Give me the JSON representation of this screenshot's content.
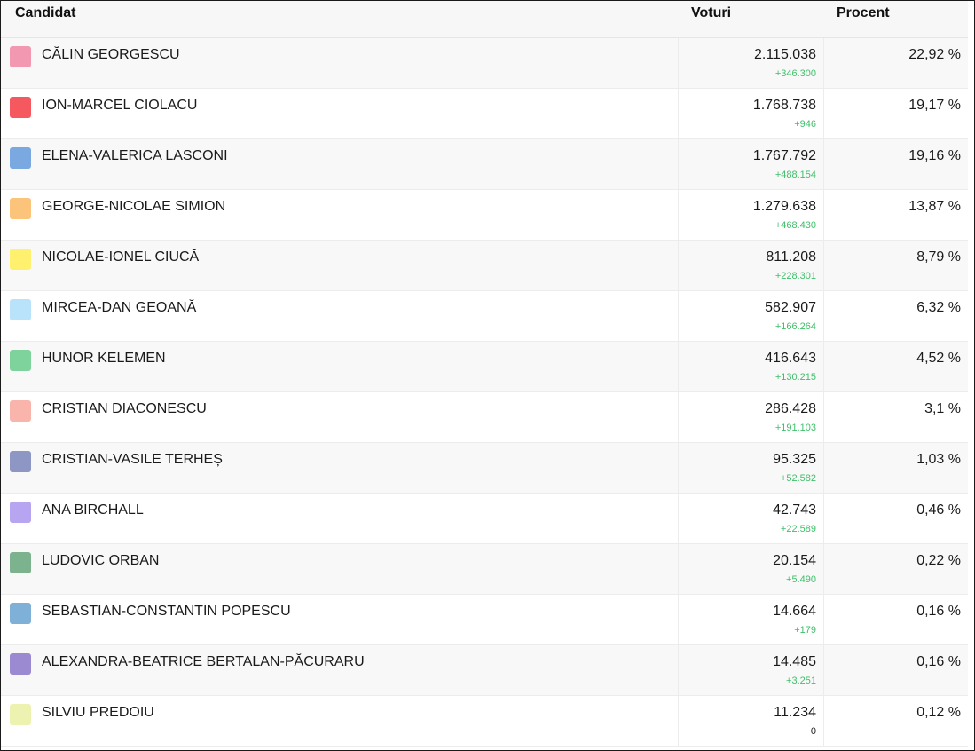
{
  "table": {
    "headers": {
      "candidate": "Candidat",
      "votes": "Voturi",
      "percent": "Procent"
    },
    "rows": [
      {
        "name": "CĂLIN GEORGESCU",
        "votes": "2.115.038",
        "delta": "+346.300",
        "percent": "22,92 %",
        "color": "#f299b1"
      },
      {
        "name": "ION-MARCEL CIOLACU",
        "votes": "1.768.738",
        "delta": "+946",
        "percent": "19,17 %",
        "color": "#f5585f"
      },
      {
        "name": "ELENA-VALERICA LASCONI",
        "votes": "1.767.792",
        "delta": "+488.154",
        "percent": "19,16 %",
        "color": "#79a9e0"
      },
      {
        "name": "GEORGE-NICOLAE SIMION",
        "votes": "1.279.638",
        "delta": "+468.430",
        "percent": "13,87 %",
        "color": "#fbc47a"
      },
      {
        "name": "NICOLAE-IONEL CIUCĂ",
        "votes": "811.208",
        "delta": "+228.301",
        "percent": "8,79 %",
        "color": "#fff06e"
      },
      {
        "name": "MIRCEA-DAN GEOANĂ",
        "votes": "582.907",
        "delta": "+166.264",
        "percent": "6,32 %",
        "color": "#b9e2fb"
      },
      {
        "name": "HUNOR KELEMEN",
        "votes": "416.643",
        "delta": "+130.215",
        "percent": "4,52 %",
        "color": "#7ed29c"
      },
      {
        "name": "CRISTIAN DIACONESCU",
        "votes": "286.428",
        "delta": "+191.103",
        "percent": "3,1 %",
        "color": "#f9b5ab"
      },
      {
        "name": "CRISTIAN-VASILE TERHEȘ",
        "votes": "95.325",
        "delta": "+52.582",
        "percent": "1,03 %",
        "color": "#8e97c3"
      },
      {
        "name": "ANA BIRCHALL",
        "votes": "42.743",
        "delta": "+22.589",
        "percent": "0,46 %",
        "color": "#b8a5f2"
      },
      {
        "name": "LUDOVIC ORBAN",
        "votes": "20.154",
        "delta": "+5.490",
        "percent": "0,22 %",
        "color": "#7cb38e"
      },
      {
        "name": "SEBASTIAN-CONSTANTIN POPESCU",
        "votes": "14.664",
        "delta": "+179",
        "percent": "0,16 %",
        "color": "#7fb0d8"
      },
      {
        "name": "ALEXANDRA-BEATRICE BERTALAN-PĂCURARU",
        "votes": "14.485",
        "delta": "+3.251",
        "percent": "0,16 %",
        "color": "#9b8ad2"
      },
      {
        "name": "SILVIU PREDOIU",
        "votes": "11.234",
        "delta": "0",
        "percent": "0,12 %",
        "color": "#eef2b0"
      }
    ]
  }
}
